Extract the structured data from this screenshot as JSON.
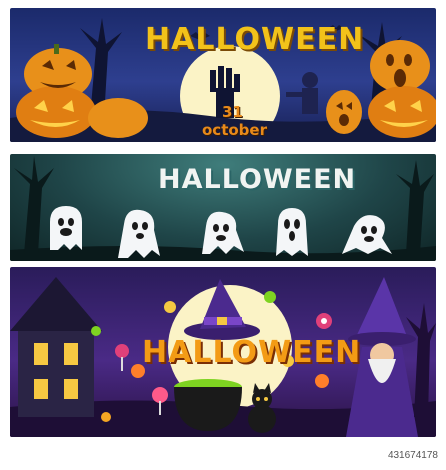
{
  "banner1": {
    "title": "HALLOWEEN",
    "date_day": "31",
    "date_month": "october"
  },
  "banner2": {
    "title": "HALLOWEEN"
  },
  "banner3": {
    "title": "HALLOWEEN"
  },
  "footer": {
    "image_id": "431674178"
  },
  "colors": {
    "title1": "#f2c21a",
    "title2": "#f1f4f2",
    "title3": "#f39b15",
    "pumpkin": "#e8901a",
    "moon": "#fbf3c6",
    "ghost": "#f4f6f8",
    "potion": "#7ed321"
  }
}
